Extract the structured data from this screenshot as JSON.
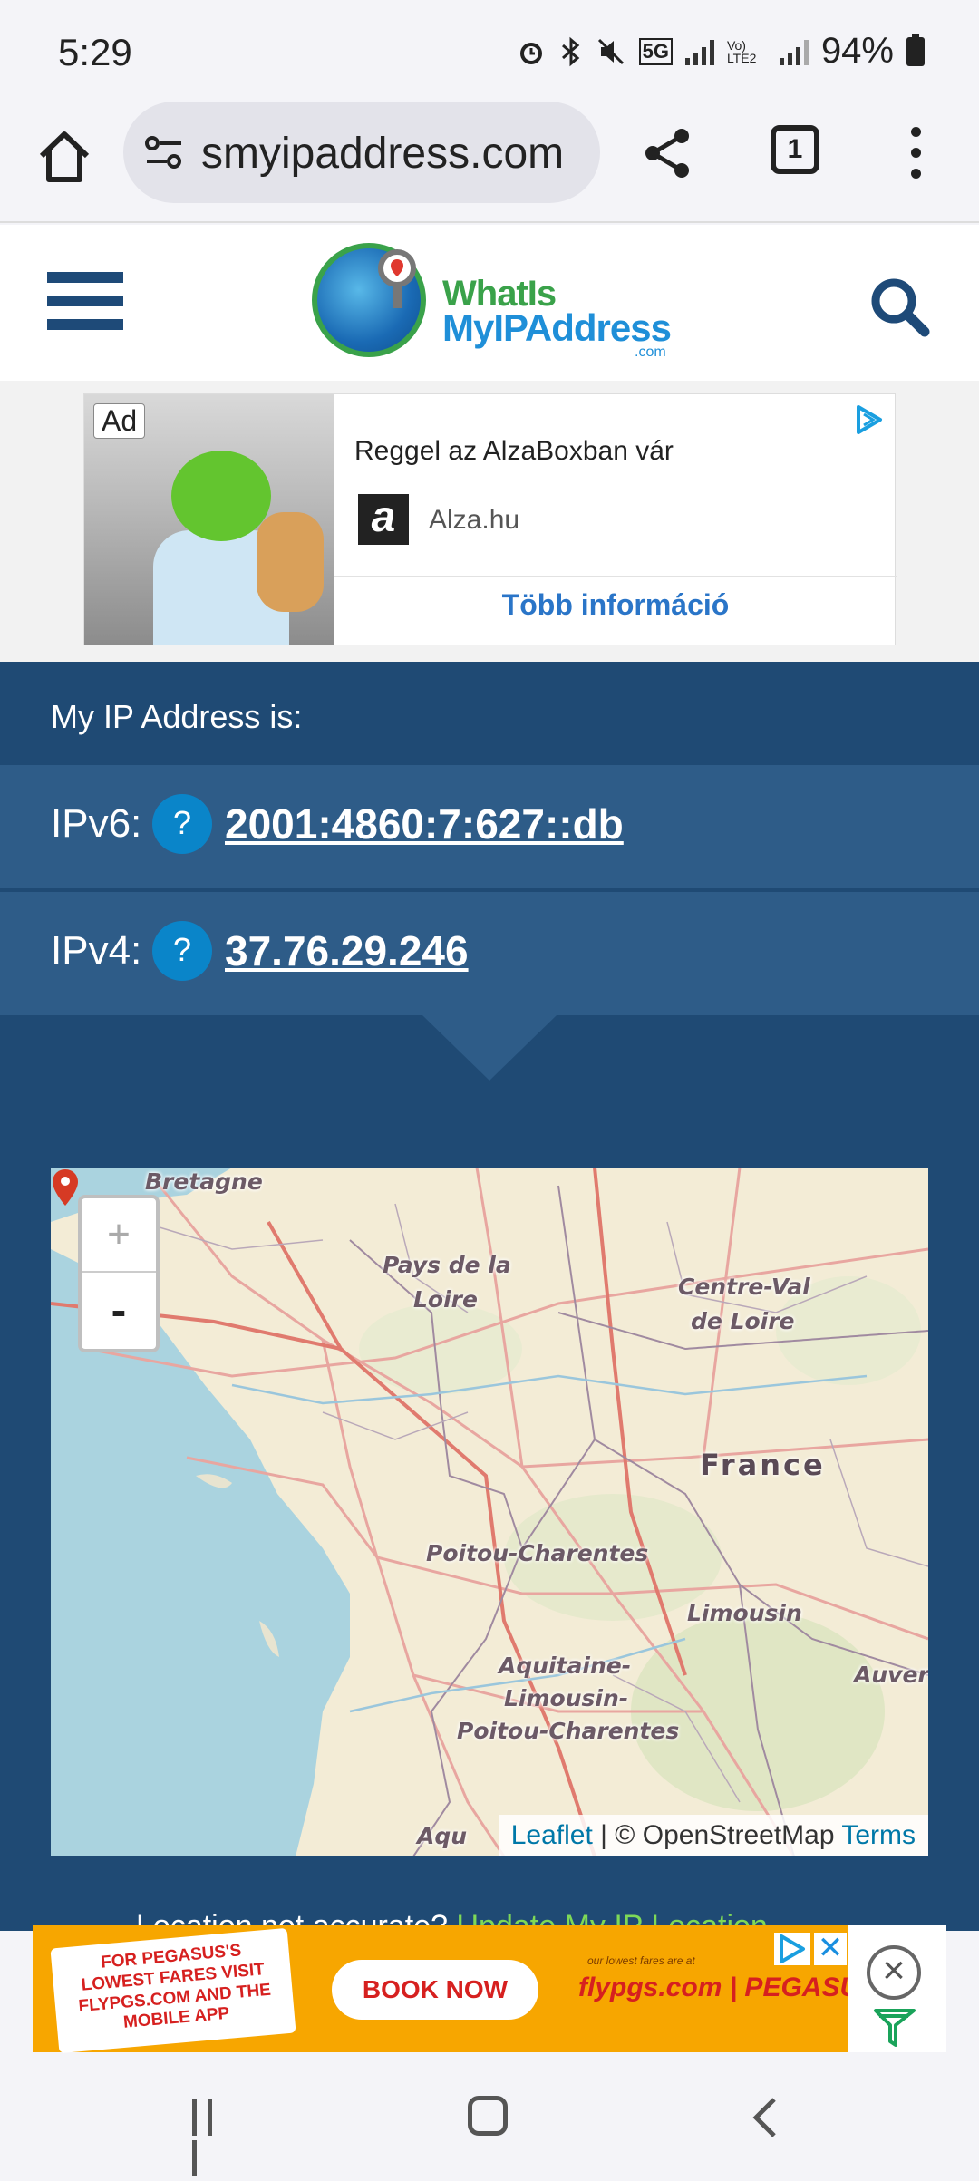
{
  "status_bar": {
    "time": "5:29",
    "network": "5G",
    "volte": "Vo) LTE2",
    "battery": "94%"
  },
  "browser": {
    "url": "smyipaddress.com",
    "tab_count": "1"
  },
  "site": {
    "logo_line1": "WhatIs",
    "logo_line2": "MyIPAddress",
    "logo_suffix": ".com"
  },
  "top_ad": {
    "badge": "Ad",
    "title": "Reggel az AlzaBoxban vár",
    "brand_logo": "a",
    "brand": "Alza.hu",
    "cta": "Több információ"
  },
  "ip_section": {
    "heading": "My IP Address is:",
    "ipv6_label": "IPv6:",
    "ipv6_value": "2001:4860:7:627::db",
    "ipv4_label": "IPv4:",
    "ipv4_value": "37.76.29.246",
    "help_symbol": "?"
  },
  "map": {
    "labels": {
      "bretagne": "Bretagne",
      "pays_de_la_loire_1": "Pays de la",
      "pays_de_la_loire_2": "Loire",
      "centre_val_1": "Centre-Val",
      "centre_val_2": "de Loire",
      "france": "France",
      "poitou": "Poitou-Charentes",
      "limousin": "Limousin",
      "aquitaine_1": "Aquitaine-",
      "aquitaine_2": "Limousin-",
      "aquitaine_3": "Poitou-Charentes",
      "auvergne": "Auverg",
      "aqu": "Aqu"
    },
    "zoom_in": "+",
    "zoom_out": "-",
    "attribution_leaflet": "Leaflet",
    "attribution_sep": "| © OpenStreetMap",
    "attribution_terms": "Terms"
  },
  "location_prompt": {
    "text": "Location not accurate?",
    "link": "Update My IP Location"
  },
  "bottom_ad": {
    "ticket_text": "FOR PEGASUS'S LOWEST FARES VISIT FLYPGS.COM AND THE MOBILE APP",
    "cta": "BOOK NOW",
    "tagline": "our lowest fares are at",
    "brand": "flypgs.com | PEGASUS",
    "close": "✕",
    "dismiss": "×"
  },
  "colors": {
    "section_bg": "#1f4a74",
    "row_bg": "#2e5c88",
    "help_bubble": "#0a85c9",
    "link_green": "#7ed957",
    "ad_orange": "#f7a600",
    "pegasus_red": "#d6201f"
  }
}
